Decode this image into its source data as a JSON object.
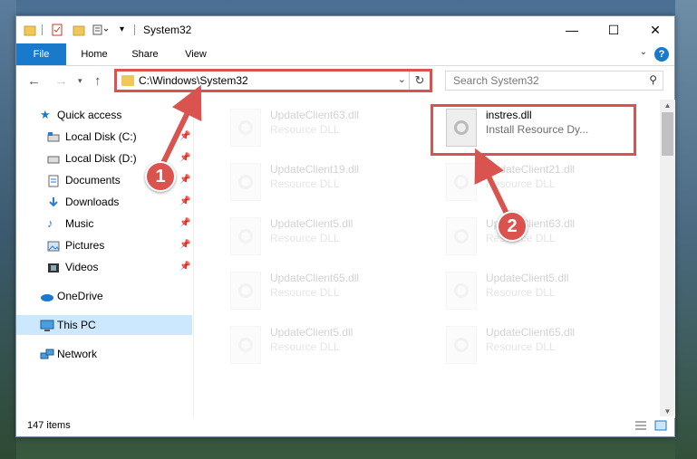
{
  "window": {
    "title": "System32",
    "controls": {
      "minimize": "—",
      "maximize": "☐",
      "close": "✕"
    }
  },
  "ribbon": {
    "tabs": [
      "File",
      "Home",
      "Share",
      "View"
    ],
    "help": "?"
  },
  "navbar": {
    "address": "C:\\Windows\\System32",
    "search_placeholder": "Search System32"
  },
  "navpane": {
    "items": [
      {
        "label": "Quick access",
        "icon": "star-icon",
        "pinned": false
      },
      {
        "label": "Local Disk (C:)",
        "icon": "drive-icon",
        "pinned": true
      },
      {
        "label": "Local Disk (D:)",
        "icon": "drive-icon",
        "pinned": true
      },
      {
        "label": "Documents",
        "icon": "documents-icon",
        "pinned": true
      },
      {
        "label": "Downloads",
        "icon": "downloads-icon",
        "pinned": true
      },
      {
        "label": "Music",
        "icon": "music-icon",
        "pinned": true
      },
      {
        "label": "Pictures",
        "icon": "pictures-icon",
        "pinned": true
      },
      {
        "label": "Videos",
        "icon": "videos-icon",
        "pinned": true
      },
      {
        "label": "OneDrive",
        "icon": "onedrive-icon",
        "pinned": false
      },
      {
        "label": "This PC",
        "icon": "this-pc-icon",
        "pinned": false
      },
      {
        "label": "Network",
        "icon": "network-icon",
        "pinned": false
      }
    ],
    "selected": "This PC"
  },
  "files": [
    {
      "name": "UpdateClient63.dll",
      "type": "Resource DLL",
      "highlighted": false
    },
    {
      "name": "instres.dll",
      "type": "Install Resource Dy...",
      "highlighted": true
    },
    {
      "name": "UpdateClient19.dll",
      "type": "Resource DLL",
      "highlighted": false
    },
    {
      "name": "UpdateClient21.dll",
      "type": "Resource DLL",
      "highlighted": false
    },
    {
      "name": "UpdateClient5.dll",
      "type": "Resource DLL",
      "highlighted": false
    },
    {
      "name": "UpdateClient63.dll",
      "type": "Resource DLL",
      "highlighted": false
    },
    {
      "name": "UpdateClient65.dll",
      "type": "Resource DLL",
      "highlighted": false
    },
    {
      "name": "UpdateClient5.dll",
      "type": "Resource DLL",
      "highlighted": false
    },
    {
      "name": "UpdateClient5.dll",
      "type": "Resource DLL",
      "highlighted": false
    },
    {
      "name": "UpdateClient65.dll",
      "type": "Resource DLL",
      "highlighted": false
    }
  ],
  "status": {
    "items_count": "147 items"
  },
  "callouts": [
    "1",
    "2"
  ],
  "colors": {
    "accent": "#1979ca",
    "callout": "#d9534f",
    "selected": "#cce8ff"
  }
}
